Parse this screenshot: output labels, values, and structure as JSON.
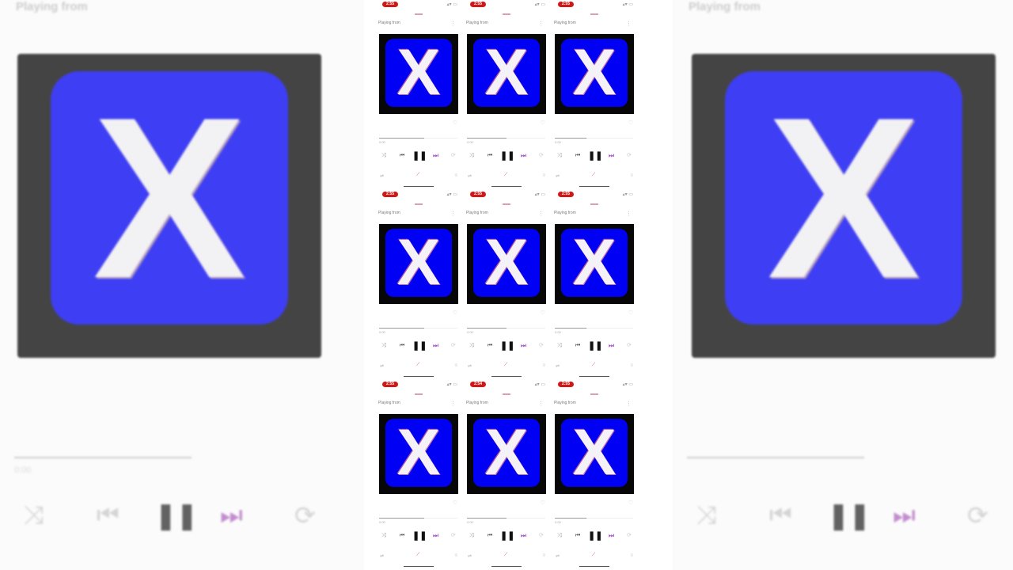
{
  "backdrop_left": {
    "header": "Playing from",
    "subheader": "",
    "watermark": "",
    "song_title": "",
    "artist": "",
    "time_elapsed": "0:00",
    "time_total": "",
    "progress": 0.52
  },
  "backdrop_right": {
    "header": "Playing from",
    "subheader": "",
    "watermark": "",
    "song_title": "",
    "artist": "",
    "time_elapsed": "",
    "time_total": "",
    "progress": 0.52
  },
  "colors": {
    "accent_red": "#d01818",
    "accent_purple": "#a040c0",
    "art_blue": "#0000f5",
    "art_border": "#070707"
  },
  "icons": {
    "shuffle": "shuffle-icon",
    "previous": "skip-previous-icon",
    "pause": "pause-icon",
    "next": "skip-next-icon",
    "repeat": "repeat-icon",
    "more": "more-icon",
    "like": "like-icon",
    "cast": "cast-icon",
    "queue": "queue-icon"
  },
  "art_letter": "X",
  "frames": [
    {
      "time": "2:55",
      "header": "Playing from",
      "progress": 0.58,
      "elapsed": "0:00",
      "total": ""
    },
    {
      "time": "2:55",
      "header": "Playing from",
      "progress": 0.5,
      "elapsed": "0:00",
      "total": ""
    },
    {
      "time": "2:55",
      "header": "Playing from",
      "progress": 0.4,
      "elapsed": "0:00",
      "total": ""
    },
    {
      "time": "2:55",
      "header": "Playing from",
      "progress": 0.58,
      "elapsed": "0:00",
      "total": ""
    },
    {
      "time": "2:55",
      "header": "Playing from",
      "progress": 0.5,
      "elapsed": "0:00",
      "total": ""
    },
    {
      "time": "2:55",
      "header": "Playing from",
      "progress": 0.4,
      "elapsed": "0:00",
      "total": ""
    },
    {
      "time": "2:55",
      "header": "Playing from",
      "progress": 0.58,
      "elapsed": "0:00",
      "total": ""
    },
    {
      "time": "2:54",
      "header": "Playing from",
      "progress": 0.5,
      "elapsed": "0:00",
      "total": ""
    },
    {
      "time": "2:55",
      "header": "Playing from",
      "progress": 0.4,
      "elapsed": "0:00",
      "total": ""
    }
  ]
}
